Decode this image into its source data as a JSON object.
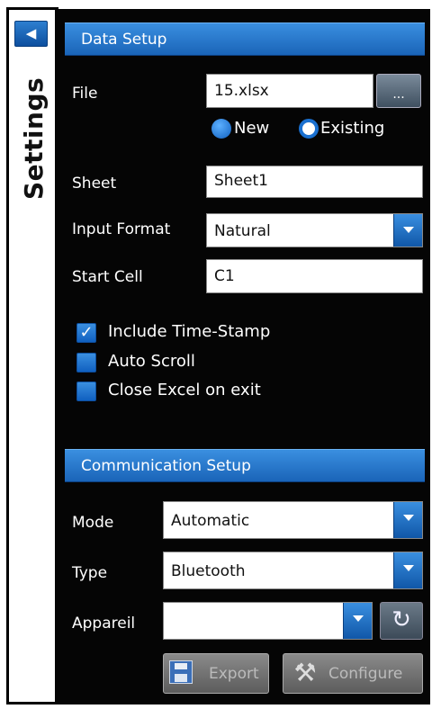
{
  "sidebar": {
    "title": "Settings",
    "collapse_icon": "chevron-left-icon"
  },
  "data_setup": {
    "header": "Data Setup",
    "file": {
      "label": "File",
      "value": "15.xlsx",
      "browse_label": "..."
    },
    "file_mode": {
      "options": [
        {
          "label": "New",
          "checked": false
        },
        {
          "label": "Existing",
          "checked": true
        }
      ]
    },
    "sheet": {
      "label": "Sheet",
      "value": "Sheet1"
    },
    "input_format": {
      "label": "Input Format",
      "value": "Natural"
    },
    "start_cell": {
      "label": "Start Cell",
      "value": "C1"
    },
    "checkboxes": [
      {
        "label": "Include Time-Stamp",
        "checked": true
      },
      {
        "label": "Auto Scroll",
        "checked": false
      },
      {
        "label": "Close Excel on exit",
        "checked": false
      }
    ]
  },
  "communication_setup": {
    "header": "Communication Setup",
    "mode": {
      "label": "Mode",
      "value": "Automatic"
    },
    "type": {
      "label": "Type",
      "value": "Bluetooth"
    },
    "device": {
      "label": "Appareil",
      "value": ""
    },
    "refresh_icon": "refresh-icon",
    "export_button": {
      "label": "Export",
      "enabled": false,
      "icon": "save-icon"
    },
    "configure_button": {
      "label": "Configure",
      "enabled": false,
      "icon": "tools-icon"
    }
  },
  "colors": {
    "accent": "#1a64b8",
    "panel": "#050505"
  }
}
